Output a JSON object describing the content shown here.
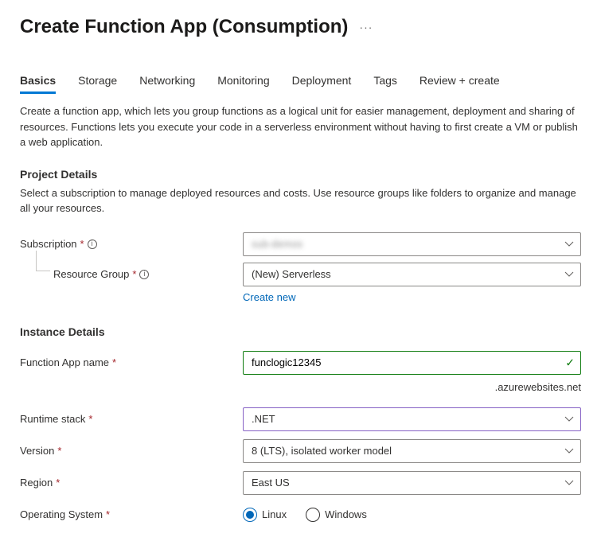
{
  "page": {
    "title": "Create Function App (Consumption)"
  },
  "tabs": {
    "items": [
      {
        "label": "Basics",
        "active": true
      },
      {
        "label": "Storage",
        "active": false
      },
      {
        "label": "Networking",
        "active": false
      },
      {
        "label": "Monitoring",
        "active": false
      },
      {
        "label": "Deployment",
        "active": false
      },
      {
        "label": "Tags",
        "active": false
      },
      {
        "label": "Review + create",
        "active": false
      }
    ]
  },
  "intro": "Create a function app, which lets you group functions as a logical unit for easier management, deployment and sharing of resources. Functions lets you execute your code in a serverless environment without having to first create a VM or publish a web application.",
  "project": {
    "title": "Project Details",
    "desc": "Select a subscription to manage deployed resources and costs. Use resource groups like folders to organize and manage all your resources.",
    "subscription_label": "Subscription",
    "subscription_value": "sub-demos",
    "rg_label": "Resource Group",
    "rg_value": "(New) Serverless",
    "create_new": "Create new"
  },
  "instance": {
    "title": "Instance Details",
    "name_label": "Function App name",
    "name_value": "funclogic12345",
    "name_suffix": ".azurewebsites.net",
    "runtime_label": "Runtime stack",
    "runtime_value": ".NET",
    "version_label": "Version",
    "version_value": "8 (LTS), isolated worker model",
    "region_label": "Region",
    "region_value": "East US",
    "os_label": "Operating System",
    "os_options": {
      "linux": "Linux",
      "windows": "Windows"
    },
    "os_selected": "linux"
  }
}
